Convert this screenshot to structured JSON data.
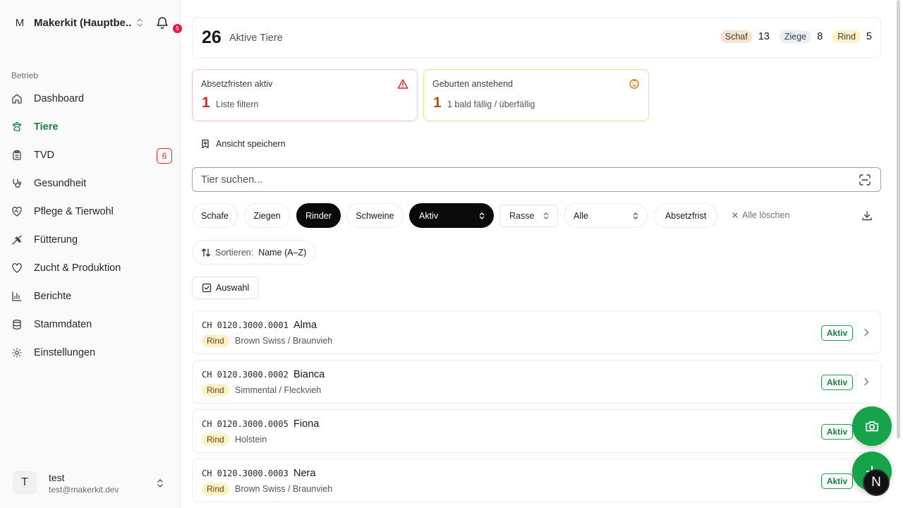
{
  "workspace": {
    "initial": "M",
    "name": "Makerkit (Hauptbe...",
    "notifications": "5"
  },
  "sidebar": {
    "section": "Betrieb",
    "items": [
      {
        "label": "Dashboard",
        "icon": "home-icon"
      },
      {
        "label": "Tiere",
        "icon": "paw-icon",
        "active": true
      },
      {
        "label": "TVD",
        "icon": "clipboard-icon",
        "badge": "6"
      },
      {
        "label": "Gesundheit",
        "icon": "stethoscope-icon"
      },
      {
        "label": "Pflege & Tierwohl",
        "icon": "heart-handshake-icon"
      },
      {
        "label": "Fütterung",
        "icon": "wheat-icon"
      },
      {
        "label": "Zucht & Produktion",
        "icon": "heart-icon"
      },
      {
        "label": "Berichte",
        "icon": "bar-chart-icon"
      },
      {
        "label": "Stammdaten",
        "icon": "database-icon"
      },
      {
        "label": "Einstellungen",
        "icon": "gear-icon"
      }
    ]
  },
  "user": {
    "initial": "T",
    "name": "test",
    "email": "test@makerkit.dev"
  },
  "stats": {
    "count": "26",
    "label": "Aktive Tiere",
    "species": [
      {
        "name": "Schaf",
        "count": "13",
        "color": "#f8e3d0"
      },
      {
        "name": "Ziege",
        "count": "8",
        "color": "#e6eef8"
      },
      {
        "name": "Rind",
        "count": "5",
        "color": "#fdf1c7"
      }
    ]
  },
  "alerts": {
    "weaning": {
      "title": "Absetzfristen aktiv",
      "count": "1",
      "sub": "Liste filtern",
      "icon": "warning-icon"
    },
    "births": {
      "title": "Geburten anstehend",
      "count": "1",
      "sub": "1 bald fällig / überfällig",
      "icon": "baby-icon"
    }
  },
  "save_view": "Ansicht speichern",
  "search": {
    "placeholder": "Tier suchen..."
  },
  "filters": {
    "species": [
      "Schafe",
      "Ziegen",
      "Rinder",
      "Schweine"
    ],
    "selected_species": "Rinder",
    "status": "Aktiv",
    "breed": "Rasse",
    "group": "Alle",
    "weaning": "Absetzfrist",
    "clear": "Alle löschen"
  },
  "sort": {
    "label": "Sortieren:",
    "value": "Name (A–Z)"
  },
  "selection_button": "Auswahl",
  "animals": [
    {
      "id": "CH 0120.3000.0001",
      "name": "Alma",
      "species": "Rind",
      "breed": "Brown Swiss / Braunvieh",
      "status": "Aktiv"
    },
    {
      "id": "CH 0120.3000.0002",
      "name": "Bianca",
      "species": "Rind",
      "breed": "Simmental / Fleckvieh",
      "status": "Aktiv"
    },
    {
      "id": "CH 0120.3000.0005",
      "name": "Fiona",
      "species": "Rind",
      "breed": "Holstein",
      "status": "Aktiv"
    },
    {
      "id": "CH 0120.3000.0003",
      "name": "Nera",
      "species": "Rind",
      "breed": "Brown Swiss / Braunvieh",
      "status": "Aktiv"
    }
  ],
  "fab": {
    "camera_icon": "camera-icon",
    "add_icon": "plus-icon"
  },
  "assistant_button": "N"
}
